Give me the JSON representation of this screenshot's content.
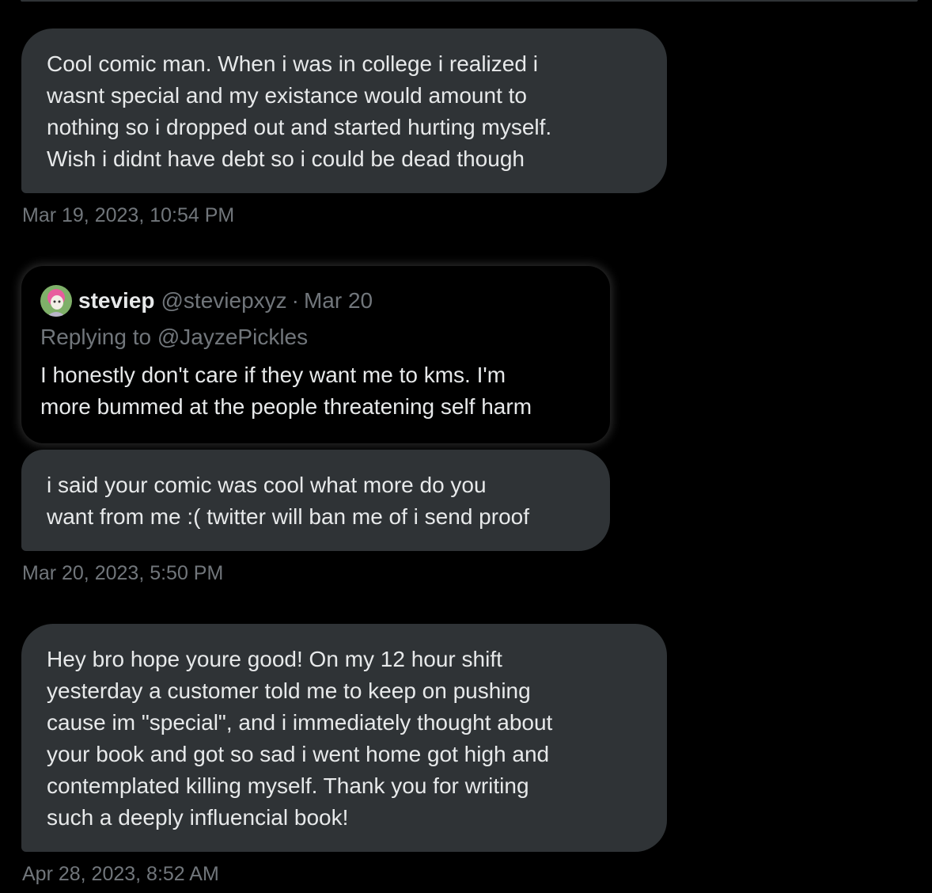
{
  "messages": [
    {
      "text": "Cool comic man. When i was in college i realized i\nwasnt special and my existance would amount to\nnothing so i dropped out and started hurting myself.\nWish i didnt have debt so i could be dead though",
      "timestamp": "Mar 19, 2023, 10:54 PM"
    },
    {
      "quote": {
        "name": "steviep",
        "handle": "@steviepxyz",
        "separator": "·",
        "date": "Mar 20",
        "replying_to": "Replying to @JayzePickles",
        "text": "I honestly don't care if they want me to kms. I'm\nmore bummed at the people threatening self harm"
      },
      "text": "i said your comic was cool what more do you\nwant from me :( twitter will ban me of i send proof",
      "timestamp": "Mar 20, 2023, 5:50 PM"
    },
    {
      "text": "Hey bro hope youre good! On my 12 hour shift\nyesterday a customer told me to keep on pushing\ncause im \"special\", and i immediately thought about\nyour book and got so sad i went home got high and\ncontemplated killing myself. Thank you for writing\nsuch a deeply influencial book!",
      "timestamp": "Apr 28, 2023, 8:52 AM"
    }
  ],
  "colors": {
    "background": "#000000",
    "bubble": "#2f3336",
    "text_primary": "#e7e9ea",
    "text_secondary": "#71767b"
  },
  "icons": {
    "avatar": "avatar-illustration"
  }
}
